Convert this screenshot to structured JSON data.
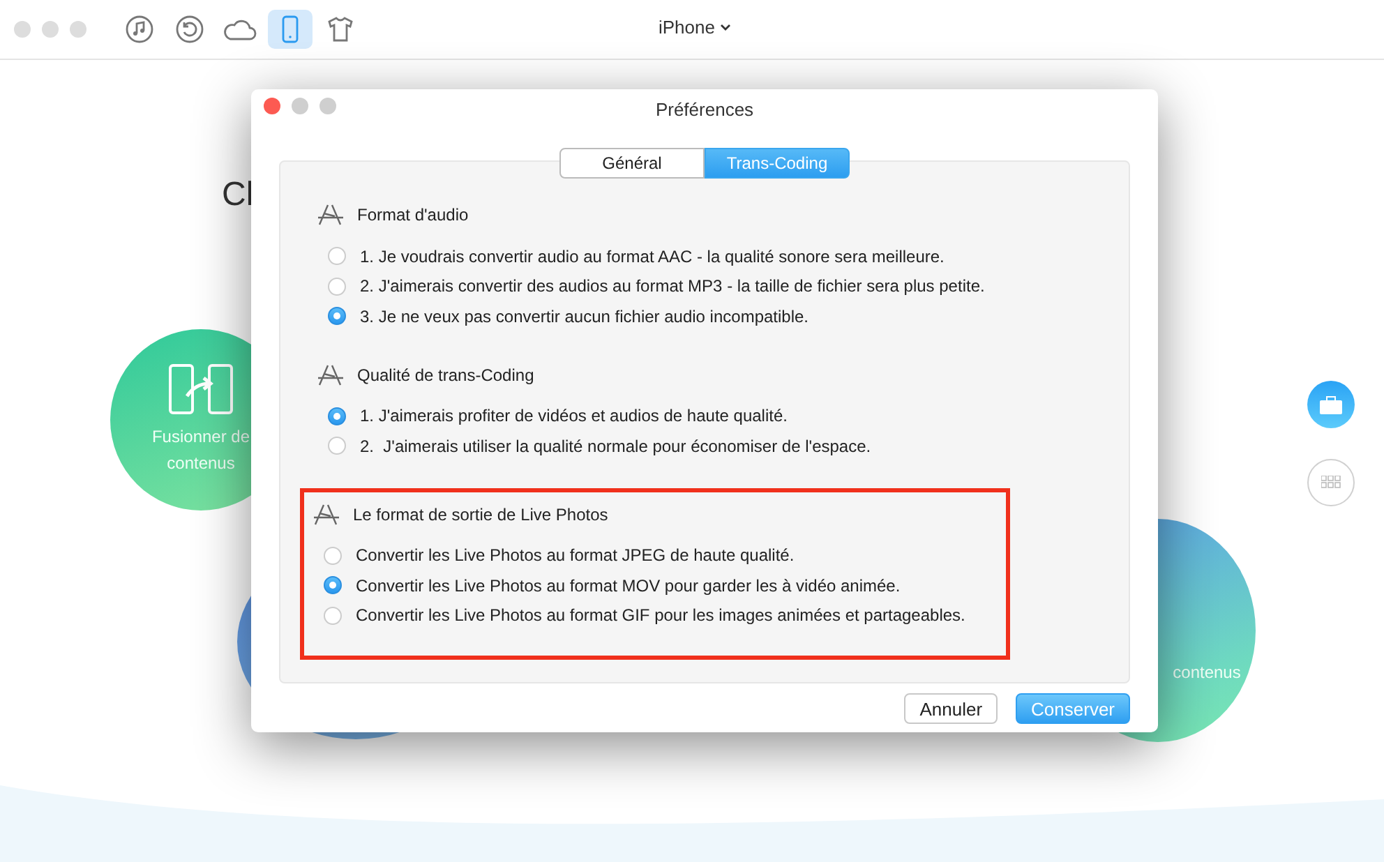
{
  "toolbar": {
    "items": [
      {
        "kind": "music",
        "selected": false
      },
      {
        "kind": "restore",
        "selected": false
      },
      {
        "kind": "cloud",
        "selected": false
      },
      {
        "kind": "phone",
        "selected": true
      },
      {
        "kind": "shirt",
        "selected": false
      }
    ],
    "device_menu": {
      "label": "iPhone"
    }
  },
  "background": {
    "title_fragment": "Cl",
    "cards": [
      {
        "kind": "merge",
        "lines": [
          "Fusionner de",
          "contenus"
        ]
      },
      {
        "kind": "other",
        "lines": [
          "contenus"
        ]
      }
    ],
    "side_buttons": [
      {
        "kind": "toolbox",
        "selected": true
      },
      {
        "kind": "grid",
        "selected": false
      }
    ]
  },
  "dialog": {
    "title": "Préférences",
    "tabs": [
      {
        "label": "Général",
        "selected": false
      },
      {
        "label": "Trans-Coding",
        "selected": true
      }
    ],
    "sections": [
      {
        "title": "Format d'audio",
        "highlighted": false,
        "options": [
          {
            "label": "1. Je voudrais convertir audio au format AAC - la qualité sonore sera meilleure.",
            "selected": false
          },
          {
            "label": "2. J'aimerais convertir des audios au format MP3 - la taille de fichier sera plus petite.",
            "selected": false
          },
          {
            "label": "3. Je ne veux pas convertir aucun fichier audio incompatible.",
            "selected": true
          }
        ]
      },
      {
        "title": "Qualité de trans-Coding",
        "highlighted": false,
        "options": [
          {
            "label": "1. J'aimerais profiter de vidéos et audios de haute qualité.",
            "selected": true
          },
          {
            "label": "2.  J'aimerais utiliser la qualité normale pour économiser de l'espace.",
            "selected": false
          }
        ]
      },
      {
        "title": "Le format de sortie de Live Photos",
        "highlighted": true,
        "options": [
          {
            "label": "Convertir les Live Photos au format JPEG de haute qualité.",
            "selected": false
          },
          {
            "label": "Convertir les Live Photos au format MOV pour garder les à vidéo animée.",
            "selected": true
          },
          {
            "label": "Convertir les Live Photos au format GIF pour les images animées et partageables.",
            "selected": false
          }
        ]
      }
    ],
    "buttons": [
      {
        "label": "Annuler",
        "kind": "secondary"
      },
      {
        "label": "Conserver",
        "kind": "primary"
      }
    ]
  }
}
